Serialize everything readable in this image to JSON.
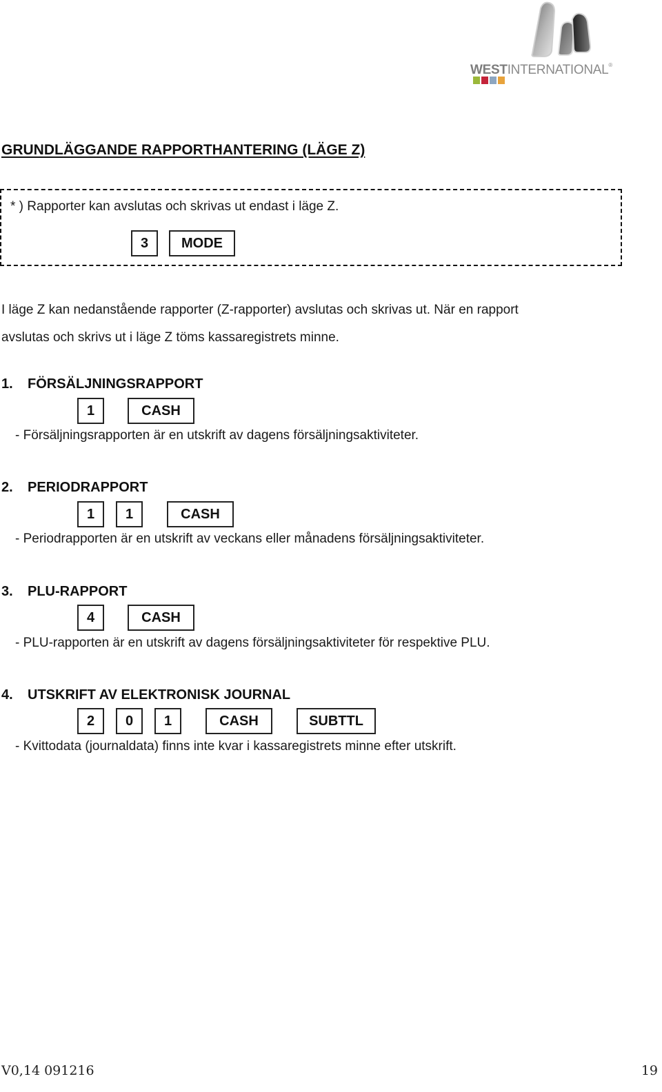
{
  "logo": {
    "brand_bold": "WEST",
    "brand_rest": "INTERNATIONAL",
    "registered_mark": "®",
    "square_colors": [
      "#9bb83a",
      "#c4243a",
      "#8ea6c0",
      "#e8a33c"
    ]
  },
  "title": "GRUNDLÄGGANDE RAPPORTHANTERING (LÄGE Z)",
  "note": {
    "text": "* ) Rapporter kan avslutas och skrivas ut endast i läge Z.",
    "keys": [
      "3",
      "MODE"
    ]
  },
  "intro": {
    "line1": "I läge Z kan nedanstående rapporter (Z-rapporter) avslutas och skrivas ut. När en rapport",
    "line2": "avslutas och skrivs ut i läge Z töms kassaregistrets minne."
  },
  "sections": [
    {
      "number": "1.",
      "heading": "FÖRSÄLJNINGSRAPPORT",
      "keys": [
        "1",
        "CASH"
      ],
      "description": "- Försäljningsrapporten är en utskrift av dagens försäljningsaktiviteter."
    },
    {
      "number": "2.",
      "heading": "PERIODRAPPORT",
      "keys": [
        "1",
        "1",
        "CASH"
      ],
      "description": "- Periodrapporten är en utskrift av veckans eller månadens försäljningsaktiviteter."
    },
    {
      "number": "3.",
      "heading": "PLU-RAPPORT",
      "keys": [
        "4",
        "CASH"
      ],
      "description": "- PLU-rapporten är en utskrift av dagens försäljningsaktiviteter för respektive PLU."
    },
    {
      "number": "4.",
      "heading": "UTSKRIFT AV ELEKTRONISK JOURNAL",
      "keys": [
        "2",
        "0",
        "1",
        "CASH",
        "SUBTTL"
      ],
      "description": "- Kvittodata (journaldata) finns inte kvar i kassaregistrets minne efter utskrift."
    }
  ],
  "footer": {
    "version": "V0,14 091216",
    "page_number": "19"
  }
}
